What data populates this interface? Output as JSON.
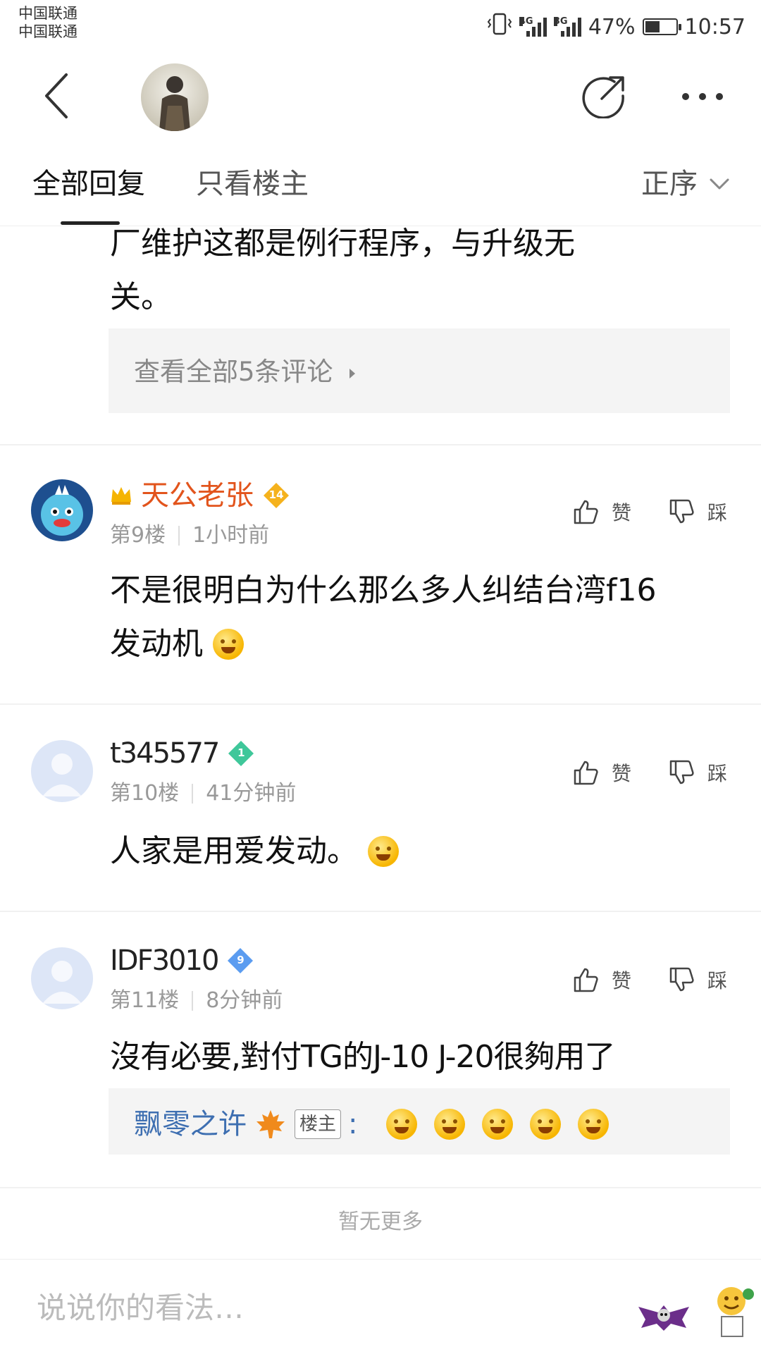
{
  "status_bar": {
    "carrier_1": "中国联通",
    "carrier_2": "中国联通",
    "network_1": "4G",
    "network_2": "3G",
    "battery": "47%",
    "battery_level": 0.47,
    "time": "10:57"
  },
  "tabs": {
    "all_replies": "全部回复",
    "owner_only": "只看楼主",
    "sort": "正序"
  },
  "prev_reply": {
    "text_line1": "厂维护这都是例行程序，与升级无",
    "text_line2": "关。",
    "view_comments": "查看全部5条评论"
  },
  "actions": {
    "like": "赞",
    "dislike": "踩"
  },
  "replies": [
    {
      "username": "天公老张",
      "level": "14",
      "floor": "第9楼",
      "time": "1小时前",
      "text_line1": "不是很明白为什么那么多人纠结台湾f16",
      "text_line2": "发动机"
    },
    {
      "username": "t345577",
      "level": "1",
      "floor": "第10楼",
      "time": "41分钟前",
      "text_line1": "人家是用爱发动。"
    },
    {
      "username": "IDF3010",
      "level": "9",
      "floor": "第11楼",
      "time": "8分钟前",
      "text_line1": "沒有必要,對付TG的J-10 J-20很夠用了",
      "sub_reply_user": "飘零之许",
      "sub_reply_badge": "楼主",
      "sub_reply_colon": ":"
    }
  ],
  "footer": {
    "no_more": "暂无更多",
    "input_placeholder": "说说你的看法…"
  }
}
